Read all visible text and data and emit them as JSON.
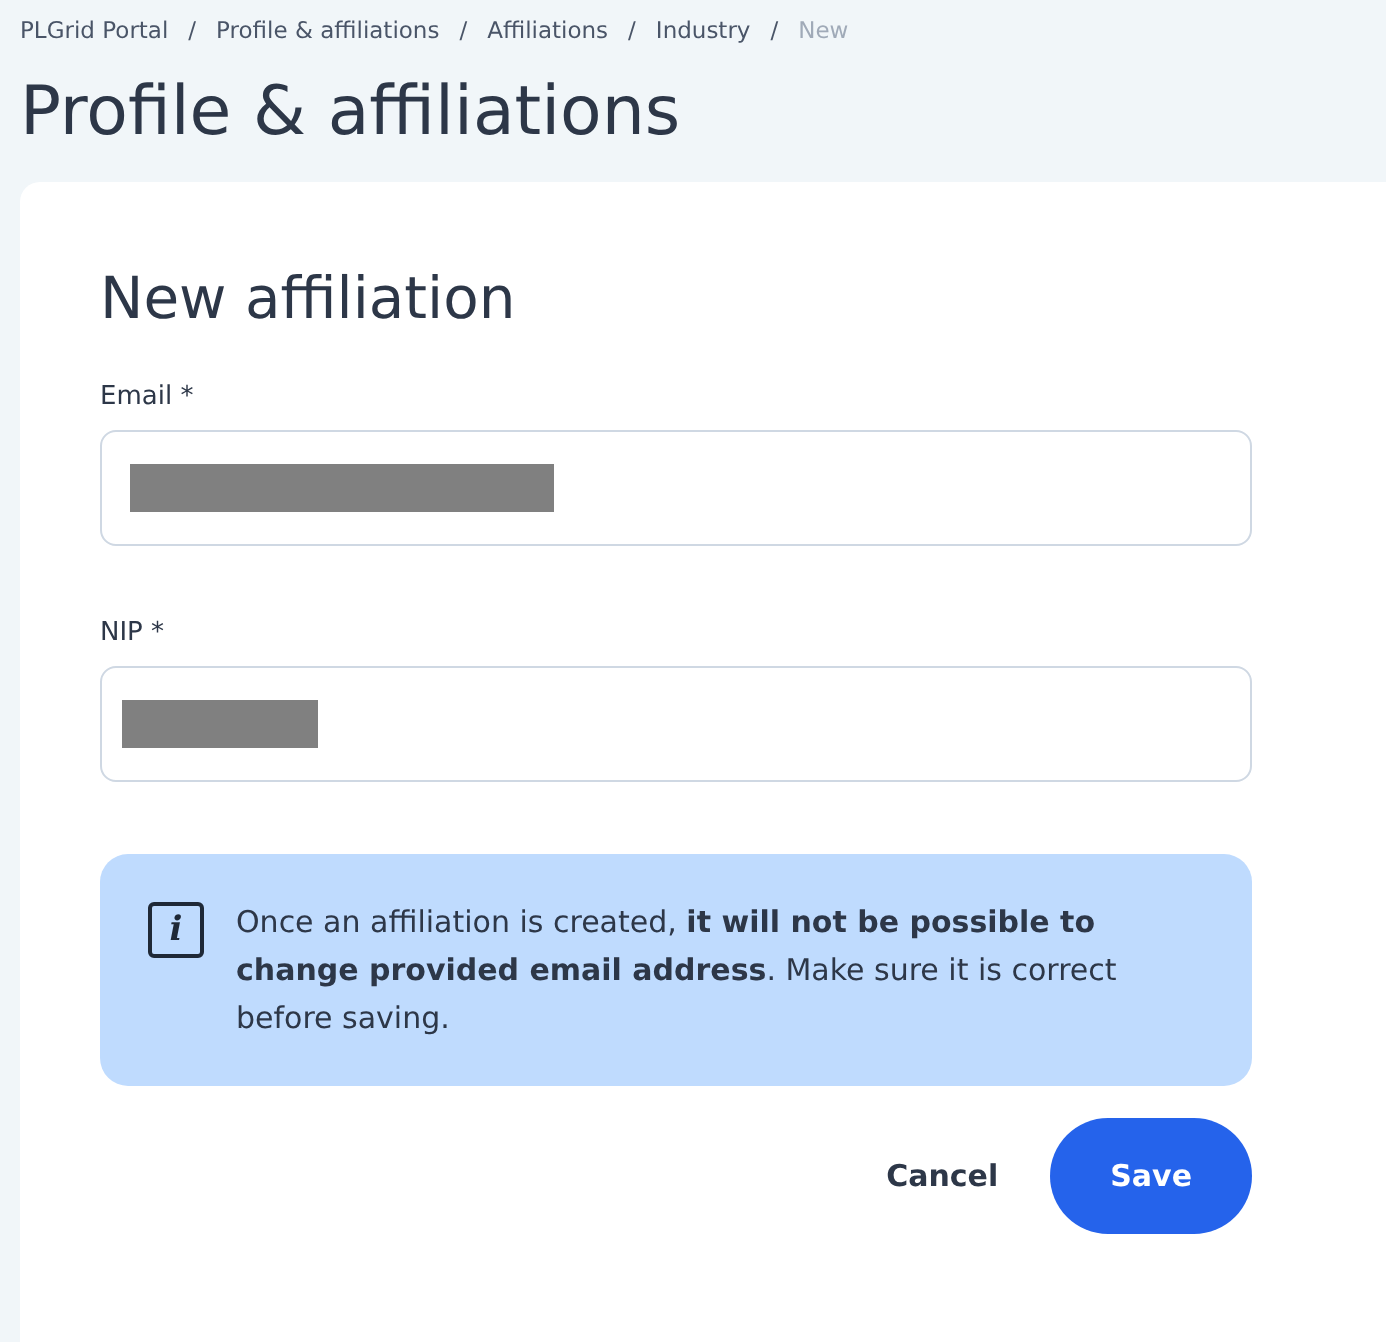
{
  "breadcrumbs": [
    {
      "label": "PLGrid Portal",
      "current": false
    },
    {
      "label": "Profile & affiliations",
      "current": false
    },
    {
      "label": "Affiliations",
      "current": false
    },
    {
      "label": "Industry",
      "current": false
    },
    {
      "label": "New",
      "current": true
    }
  ],
  "separator": "/",
  "page_title": "Profile & affiliations",
  "form": {
    "title": "New affiliation",
    "fields": [
      {
        "label": "Email *",
        "kind": "email",
        "redacted": true
      },
      {
        "label": "NIP *",
        "kind": "number",
        "redacted": true
      }
    ],
    "notice": {
      "icon": "i",
      "text": "Once an affiliation is created, **it will not be possible to change provided email address**. Make sure it is correct before saving."
    },
    "buttons": [
      {
        "label": "Cancel",
        "kind": "secondary"
      },
      {
        "label": "Save",
        "kind": "primary"
      }
    ]
  }
}
